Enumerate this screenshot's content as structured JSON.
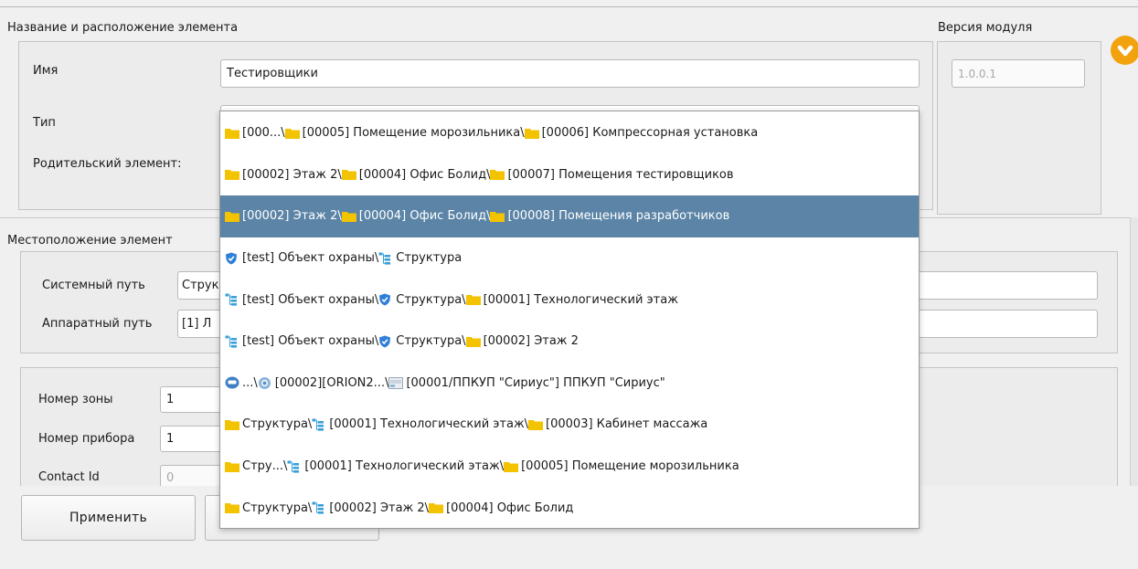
{
  "section_title": "Название и расположение элемента",
  "module_version": {
    "label": "Версия модуля",
    "value": "1.0.0.1"
  },
  "fields": {
    "name_label": "Имя",
    "name_value": "Тестировщики",
    "type_label": "Тип",
    "parent_label": "Родительский элемент:"
  },
  "location": {
    "title": "Местоположение элемент",
    "system_path_label": "Системный путь",
    "system_path_value": "Струк",
    "hardware_path_label": "Аппаратный путь",
    "hardware_path_value": "[1] Л"
  },
  "zone": {
    "zone_label": "Номер зоны",
    "zone_value": "1",
    "device_label": "Номер прибора",
    "device_value": "1",
    "contact_label": "Contact Id",
    "contact_value": "0"
  },
  "buttons": {
    "apply": "Применить"
  },
  "colors": {
    "selection": "#5b84a6",
    "folder": "#f3c300",
    "shield": "#2f7fd8",
    "accent": "#f2a20c"
  },
  "dropdown_items": [
    {
      "selected": false,
      "segments": [
        {
          "icon": "folder",
          "text": "[000...\\"
        },
        {
          "icon": "folder",
          "text": "[00005] Помещение морозильника\\"
        },
        {
          "icon": "folder",
          "text": "[00006] Компрессорная установка"
        }
      ]
    },
    {
      "selected": false,
      "segments": [
        {
          "icon": "folder",
          "text": "[00002] Этаж 2\\"
        },
        {
          "icon": "folder",
          "text": "[00004] Офис Болид\\"
        },
        {
          "icon": "folder",
          "text": "[00007] Помещения тестировщиков"
        }
      ]
    },
    {
      "selected": true,
      "segments": [
        {
          "icon": "folder",
          "text": "[00002] Этаж 2\\"
        },
        {
          "icon": "folder",
          "text": "[00004] Офис Болид\\"
        },
        {
          "icon": "folder",
          "text": "[00008] Помещения разработчиков"
        }
      ]
    },
    {
      "selected": false,
      "segments": [
        {
          "icon": "shield",
          "text": "[test] Объект охраны\\"
        },
        {
          "icon": "tree",
          "text": "Структура"
        }
      ]
    },
    {
      "selected": false,
      "segments": [
        {
          "icon": "tree",
          "text": "[test] Объект охраны\\"
        },
        {
          "icon": "shield",
          "text": "Структура\\"
        },
        {
          "icon": "folder",
          "text": "[00001] Технологический этаж"
        }
      ]
    },
    {
      "selected": false,
      "segments": [
        {
          "icon": "tree",
          "text": "[test] Объект охраны\\"
        },
        {
          "icon": "shield",
          "text": "Структура\\"
        },
        {
          "icon": "folder",
          "text": "[00002] Этаж 2"
        }
      ]
    },
    {
      "selected": false,
      "segments": [
        {
          "icon": "device",
          "text": "...\\"
        },
        {
          "icon": "gear",
          "text": "[00002][ORION2...\\"
        },
        {
          "icon": "panel",
          "text": "[00001/ППКУП \"Сириус\"] ППКУП \"Сириус\""
        }
      ]
    },
    {
      "selected": false,
      "segments": [
        {
          "icon": "folder",
          "text": "Структура\\"
        },
        {
          "icon": "tree",
          "text": "[00001] Технологический этаж\\"
        },
        {
          "icon": "folder",
          "text": "[00003] Кабинет массажа"
        }
      ]
    },
    {
      "selected": false,
      "segments": [
        {
          "icon": "folder",
          "text": "Стру...\\"
        },
        {
          "icon": "tree",
          "text": "[00001] Технологический этаж\\"
        },
        {
          "icon": "folder",
          "text": "[00005] Помещение морозильника"
        }
      ]
    },
    {
      "selected": false,
      "segments": [
        {
          "icon": "folder",
          "text": "Структура\\"
        },
        {
          "icon": "tree",
          "text": "[00002] Этаж 2\\"
        },
        {
          "icon": "folder",
          "text": "[00004] Офис Болид"
        }
      ]
    }
  ]
}
